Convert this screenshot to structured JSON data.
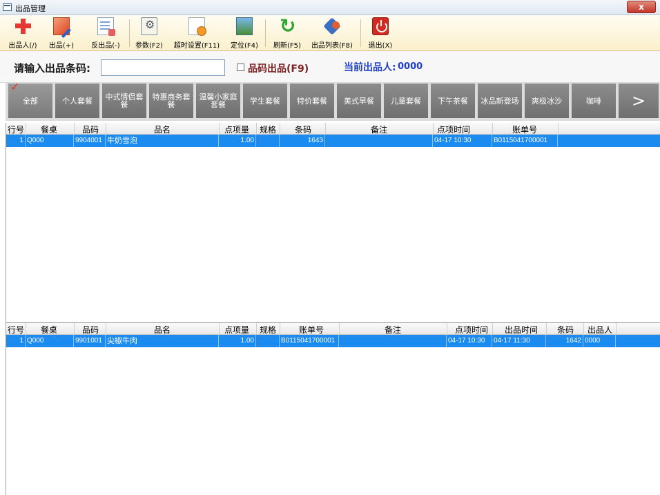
{
  "window": {
    "title": "出品管理",
    "close_glyph": "x"
  },
  "toolbar": {
    "items": [
      {
        "label": "出品人(/)",
        "icon": "add-person-icon"
      },
      {
        "label": "出品(+)",
        "icon": "edit-icon"
      },
      {
        "label": "反出品(-)",
        "icon": "document-icon"
      },
      {
        "label": "参数(F2)",
        "icon": "settings-icon"
      },
      {
        "label": "超时设置(F11)",
        "icon": "timeout-icon"
      },
      {
        "label": "定位(F4)",
        "icon": "locate-icon"
      },
      {
        "label": "刷新(F5)",
        "icon": "refresh-icon"
      },
      {
        "label": "出品列表(F8)",
        "icon": "list-icon"
      },
      {
        "label": "退出(X)",
        "icon": "power-icon"
      }
    ]
  },
  "codebar": {
    "prompt": "请输入出品条码:",
    "input_value": "",
    "checkbox_label": "品码出品(F9)",
    "checkbox_checked": false,
    "current_label": "当前出品人:",
    "current_value": "0000"
  },
  "categories": {
    "items": [
      "全部",
      "个人套餐",
      "中式情侣套餐",
      "特惠商务套餐",
      "温馨小家庭套餐",
      "学生套餐",
      "特价套餐",
      "美式早餐",
      "儿童套餐",
      "下午茶餐",
      "冰品新登场",
      "爽极冰沙",
      "咖啡"
    ],
    "active_index": 0,
    "next_glyph": ">"
  },
  "pending": {
    "headers": [
      "行号",
      "餐桌",
      "品码",
      "品名",
      "点项量",
      "规格",
      "条码",
      "备注",
      "点项时间",
      "账单号"
    ],
    "rows": [
      {
        "line": "1",
        "table": "Q000",
        "code": "9904001",
        "name": "牛奶雪泡",
        "qty": "1.00",
        "spec": "",
        "barcode": "1643",
        "note": "",
        "order_time": "04-17 10:30",
        "bill": "B0115041700001"
      }
    ]
  },
  "served": {
    "headers": [
      "行号",
      "餐桌",
      "品码",
      "品名",
      "点项量",
      "规格",
      "账单号",
      "备注",
      "点项时间",
      "出品时间",
      "条码",
      "出品人"
    ],
    "rows": [
      {
        "line": "1",
        "table": "Q000",
        "code": "9901001",
        "name": "尖椒牛肉",
        "qty": "1.00",
        "spec": "",
        "bill": "B0115041700001",
        "note": "",
        "order_time": "04-17 10:30",
        "serve_time": "04-17 11:30",
        "barcode": "1642",
        "server": "0000"
      }
    ]
  },
  "colors": {
    "selection": "#1b8bf0",
    "current_label": "#1f3fc8",
    "checkbox_label": "#7a1f1f"
  }
}
